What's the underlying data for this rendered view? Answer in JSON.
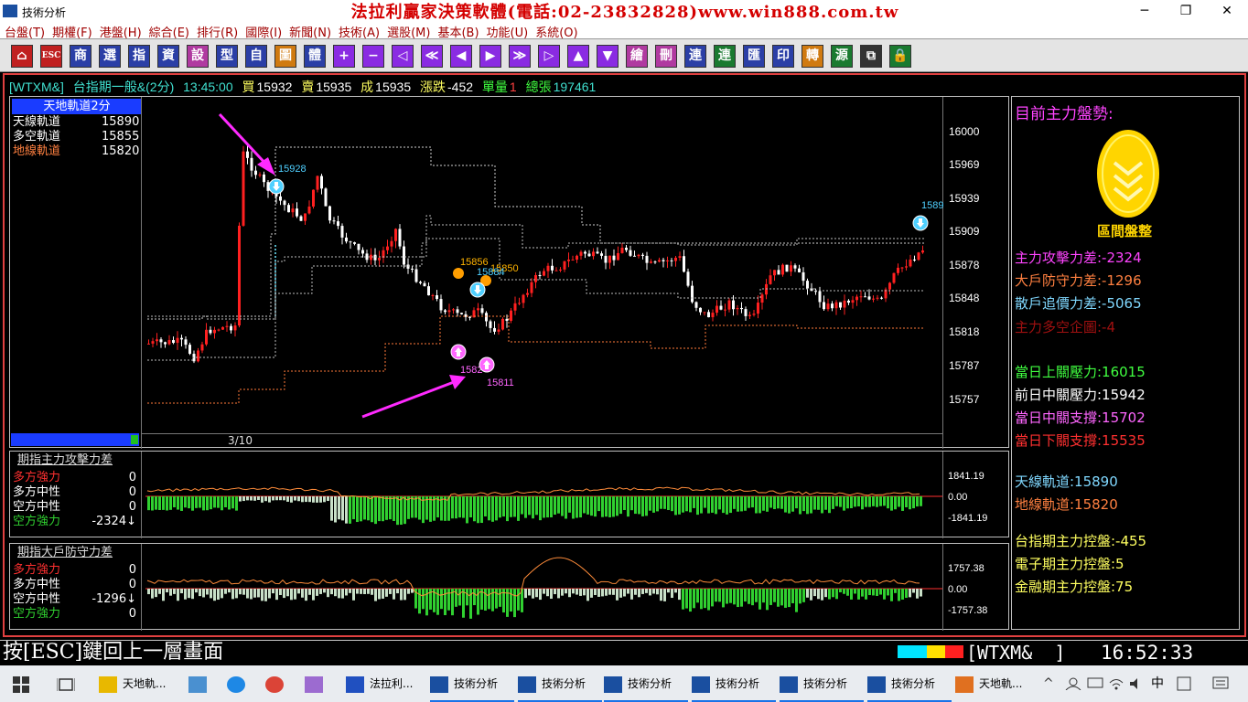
{
  "window": {
    "title": "技術分析",
    "banner": "法拉利贏家決策軟體(電話:02-23832828)www.win888.com.tw",
    "min": "─",
    "restore": "❐",
    "close": "✕"
  },
  "menu": [
    "台盤(T)",
    "期權(F)",
    "港盤(H)",
    "綜合(E)",
    "排行(R)",
    "國際(I)",
    "新聞(N)",
    "技術(A)",
    "選股(M)",
    "基本(B)",
    "功能(U)",
    "系統(O)"
  ],
  "toolbar": [
    {
      "label": "⌂",
      "color": "#c02020"
    },
    {
      "label": "ESC",
      "color": "#c02020"
    },
    {
      "label": "商",
      "color": "#2b3fa6"
    },
    {
      "label": "選",
      "color": "#2b3fa6"
    },
    {
      "label": "指",
      "color": "#2b3fa6"
    },
    {
      "label": "資",
      "color": "#2b3fa6"
    },
    {
      "label": "設",
      "color": "#b03aa0"
    },
    {
      "label": "型",
      "color": "#2b3fa6"
    },
    {
      "label": "自",
      "color": "#2b3fa6"
    },
    {
      "label": "圖",
      "color": "#d07a10"
    },
    {
      "label": "體",
      "color": "#2b3fa6"
    },
    {
      "label": "+",
      "color": "#8a2be2"
    },
    {
      "label": "−",
      "color": "#8a2be2"
    },
    {
      "label": "◁",
      "color": "#8a2be2"
    },
    {
      "label": "≪",
      "color": "#8a2be2"
    },
    {
      "label": "◀",
      "color": "#8a2be2"
    },
    {
      "label": "▶",
      "color": "#8a2be2"
    },
    {
      "label": "≫",
      "color": "#8a2be2"
    },
    {
      "label": "▷",
      "color": "#8a2be2"
    },
    {
      "label": "▲",
      "color": "#8a2be2"
    },
    {
      "label": "▼",
      "color": "#8a2be2"
    },
    {
      "label": "繪",
      "color": "#b03aa0"
    },
    {
      "label": "刪",
      "color": "#b03aa0"
    },
    {
      "label": "連",
      "color": "#2b3fa6"
    },
    {
      "label": "連",
      "color": "#1a7a30"
    },
    {
      "label": "匯",
      "color": "#2b3fa6"
    },
    {
      "label": "印",
      "color": "#2b3fa6"
    },
    {
      "label": "轉",
      "color": "#d07a10"
    },
    {
      "label": "源",
      "color": "#1a7a30"
    },
    {
      "label": "⧉",
      "color": "#333"
    },
    {
      "label": "🔒",
      "color": "#1a7a30"
    }
  ],
  "quote": {
    "symbol": "[WTXM&]",
    "name": "台指期一般&(2分)",
    "time": "13:45:00",
    "bid_label": "買",
    "bid": "15932",
    "ask_label": "賣",
    "ask": "15935",
    "trade_label": "成",
    "trade": "15935",
    "chg_label": "漲跌",
    "chg": "-452",
    "vol_label": "單量",
    "vol": "1",
    "total_label": "總張",
    "total": "197461"
  },
  "main_panel": {
    "title": "天地軌道2分",
    "rows": [
      {
        "label": "天線軌道",
        "value": "15890",
        "color": "#ffffff"
      },
      {
        "label": "多空軌道",
        "value": "15855",
        "color": "#ffffff"
      },
      {
        "label": "地線軌道",
        "value": "15820",
        "color": "#ff8040"
      }
    ],
    "date": "3/10",
    "y_ticks": [
      "16000",
      "15969",
      "15939",
      "15909",
      "15878",
      "15848",
      "15818",
      "15787",
      "15757"
    ],
    "markers": [
      {
        "text": "15928",
        "color": "#4fd0ff"
      },
      {
        "text": "15856",
        "color": "#ffb300"
      },
      {
        "text": "15850",
        "color": "#ffb300"
      },
      {
        "text": "15884",
        "color": "#4fd0ff"
      },
      {
        "text": "1582",
        "color": "#ff66ff"
      },
      {
        "text": "15811",
        "color": "#ff66ff"
      },
      {
        "text": "1589",
        "color": "#4fd0ff"
      }
    ]
  },
  "ind1": {
    "title": "期指主力攻擊力差",
    "rows": [
      {
        "label": "多方強力",
        "value": "0",
        "color": "#ff3030"
      },
      {
        "label": "多方中性",
        "value": "0",
        "color": "#ffffff"
      },
      {
        "label": "空方中性",
        "value": "0",
        "color": "#ffffff"
      },
      {
        "label": "空方強力",
        "value": "-2324↓",
        "color": "#30d030"
      }
    ],
    "ticks": [
      "1841.19",
      "0.00",
      "-1841.19"
    ]
  },
  "ind2": {
    "title": "期指大戶防守力差",
    "rows": [
      {
        "label": "多方強力",
        "value": "0",
        "color": "#ff3030"
      },
      {
        "label": "多方中性",
        "value": "0",
        "color": "#ffffff"
      },
      {
        "label": "空方中性",
        "value": "-1296↓",
        "color": "#ffffff"
      },
      {
        "label": "空方強力",
        "value": "0",
        "color": "#30d030"
      }
    ],
    "ticks": [
      "1757.38",
      "0.00",
      "-1757.38"
    ]
  },
  "right": {
    "header": "目前主力盤勢:",
    "badge": "區間盤整",
    "lines": [
      {
        "text": "主力攻擊力差:-2324",
        "color": "#ff44ff"
      },
      {
        "text": "大戶防守力差:-1296",
        "color": "#ff8040"
      },
      {
        "text": "散戶追價力差:-5065",
        "color": "#80d8ff"
      },
      {
        "text": "主力多空企圖:-4",
        "color": "#a01010"
      },
      {
        "text": "當日上關壓力:16015",
        "color": "#40ff40"
      },
      {
        "text": "前日中關壓力:15942",
        "color": "#ffffff"
      },
      {
        "text": "當日中關支撐:15702",
        "color": "#ff66ff"
      },
      {
        "text": "當日下關支撐:15535",
        "color": "#ff3030"
      },
      {
        "text": "天線軌道:15890",
        "color": "#80d8ff"
      },
      {
        "text": "地線軌道:15820",
        "color": "#ff8040"
      },
      {
        "text": "台指期主力控盤:-455",
        "color": "#ffff60"
      },
      {
        "text": "電子期主力控盤:5",
        "color": "#ffff60"
      },
      {
        "text": "金融期主力控盤:75",
        "color": "#ffff60"
      }
    ]
  },
  "status": {
    "hint": "按[ESC]鍵回上一層畫面",
    "symbol": "[WTXM&  ]",
    "clock": "16:52:33"
  },
  "taskbar": {
    "items": [
      {
        "text": "天地軌...",
        "icon": "folder-icon"
      },
      {
        "text": "",
        "icon": "pc-icon"
      },
      {
        "text": "",
        "icon": "ie-icon"
      },
      {
        "text": "",
        "icon": "chrome-icon"
      },
      {
        "text": "",
        "icon": "paint-icon"
      },
      {
        "text": "法拉利...",
        "icon": "ferrari-icon"
      },
      {
        "text": "技術分析",
        "icon": "chart-icon"
      },
      {
        "text": "技術分析",
        "icon": "chart-icon"
      },
      {
        "text": "技術分析",
        "icon": "chart-icon"
      },
      {
        "text": "技術分析",
        "icon": "chart-icon"
      },
      {
        "text": "技術分析",
        "icon": "chart-icon"
      },
      {
        "text": "技術分析",
        "icon": "chart-icon"
      },
      {
        "text": "天地軌...",
        "icon": "office-icon"
      }
    ],
    "ime": "中"
  }
}
